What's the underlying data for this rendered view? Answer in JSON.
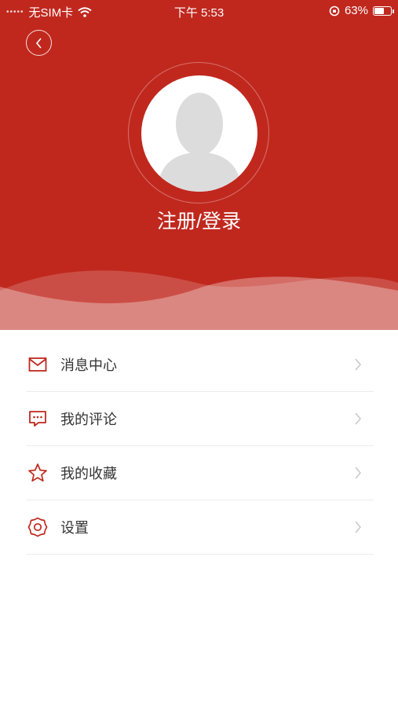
{
  "status_bar": {
    "carrier": "无SIM卡",
    "time": "下午 5:53",
    "battery_percent": "63%",
    "battery_level": 0.63
  },
  "profile": {
    "login_label": "注册/登录"
  },
  "menu": {
    "items": [
      {
        "label": "消息中心",
        "icon": "mail-icon"
      },
      {
        "label": "我的评论",
        "icon": "comment-icon"
      },
      {
        "label": "我的收藏",
        "icon": "star-icon"
      },
      {
        "label": "设置",
        "icon": "gear-icon"
      }
    ]
  },
  "colors": {
    "brand_red": "#c0281e",
    "icon_red": "#c0281e",
    "chevron": "#c8c8c8"
  }
}
